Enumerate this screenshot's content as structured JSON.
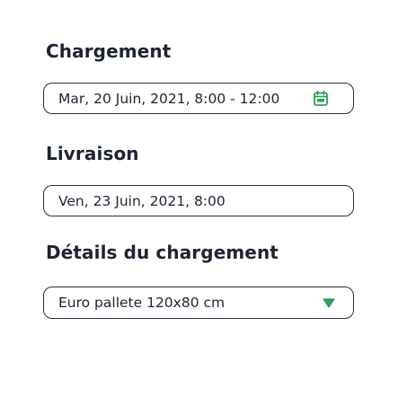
{
  "loading": {
    "title": "Chargement",
    "date_value": "Mar, 20 Juin, 2021, 8:00 - 12:00",
    "icon": "calendar-icon",
    "icon_color": "#2e9e5b"
  },
  "delivery": {
    "title": "Livraison",
    "date_value": "Ven, 23 Juin, 2021, 8:00"
  },
  "load_details": {
    "title": "Détails du chargement",
    "selected_option": "Euro pallete 120x80 cm",
    "icon": "chevron-down-icon"
  }
}
